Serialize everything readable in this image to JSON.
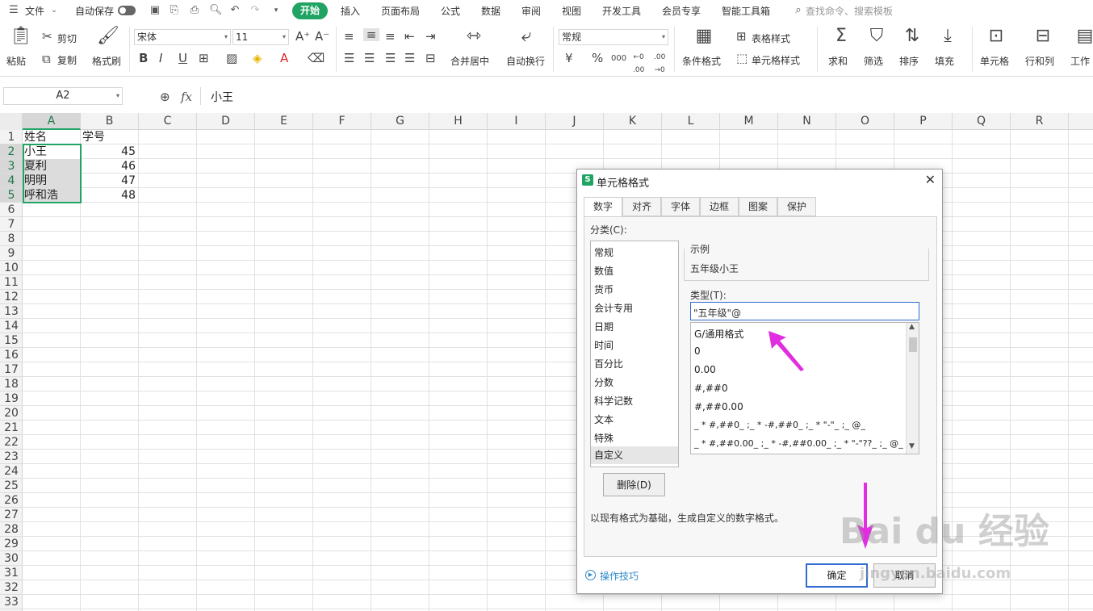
{
  "menu": {
    "file": "文件",
    "autosave": "自动保存",
    "tabs": [
      "开始",
      "插入",
      "页面布局",
      "公式",
      "数据",
      "审阅",
      "视图",
      "开发工具",
      "会员专享",
      "智能工具箱"
    ],
    "search_placeholder": "查找命令、搜索模板"
  },
  "ribbon": {
    "paste": "粘贴",
    "cut": "剪切",
    "copy": "复制",
    "format_painter": "格式刷",
    "font_name": "宋体",
    "font_size": "11",
    "number_format": "常规",
    "merge_center": "合并居中",
    "wrap_text": "自动换行",
    "cond_format": "条件格式",
    "table_style": "表格样式",
    "cell_style": "单元格样式",
    "sum": "求和",
    "filter": "筛选",
    "sort": "排序",
    "fill": "填充",
    "cell": "单元格",
    "row_col": "行和列",
    "sheet": "工作"
  },
  "formula_bar": {
    "name_box": "A2",
    "fx": "fx",
    "content": "小王"
  },
  "grid": {
    "columns": [
      "A",
      "B",
      "C",
      "D",
      "E",
      "F",
      "G",
      "H",
      "I",
      "J",
      "K",
      "L",
      "M",
      "N",
      "O",
      "P",
      "Q",
      "R"
    ],
    "rows": [
      "1",
      "2",
      "3",
      "4",
      "5",
      "6",
      "7",
      "8",
      "9",
      "10",
      "11",
      "12",
      "13",
      "14",
      "15",
      "16",
      "17",
      "18",
      "19",
      "20",
      "21",
      "22",
      "23",
      "24",
      "25",
      "26",
      "27",
      "28",
      "29",
      "30",
      "31",
      "32",
      "33"
    ],
    "data": [
      [
        "姓名",
        "学号"
      ],
      [
        "小王",
        "45"
      ],
      [
        "夏利",
        "46"
      ],
      [
        "明明",
        "47"
      ],
      [
        "呼和浩",
        "48"
      ]
    ]
  },
  "dialog": {
    "title": "单元格格式",
    "tabs": [
      "数字",
      "对齐",
      "字体",
      "边框",
      "图案",
      "保护"
    ],
    "category_label": "分类(C):",
    "categories": [
      "常规",
      "数值",
      "货币",
      "会计专用",
      "日期",
      "时间",
      "百分比",
      "分数",
      "科学记数",
      "文本",
      "特殊",
      "自定义"
    ],
    "sample_label": "示例",
    "sample_value": "五年级小王",
    "type_label": "类型(T):",
    "type_value": "\"五年级\"@",
    "type_list": [
      "G/通用格式",
      "0",
      "0.00",
      "#,##0",
      "#,##0.00",
      "_ * #,##0_ ;_ * -#,##0_ ;_ * \"-\"_ ;_ @_",
      "_ * #,##0.00_ ;_ * -#,##0.00_ ;_ * \"-\"??_ ;_ @_"
    ],
    "delete_button": "删除(D)",
    "description": "以现有格式为基础，生成自定义的数字格式。",
    "tips_link": "操作技巧",
    "ok_button": "确定",
    "cancel_button": "取消"
  },
  "watermark": {
    "brand": "Bai du 经验",
    "url": "jingyan.baidu.com"
  },
  "colors": {
    "accent_green": "#1fa463",
    "arrow_magenta": "#e02ee0",
    "primary_blue": "#2f6bd1"
  }
}
